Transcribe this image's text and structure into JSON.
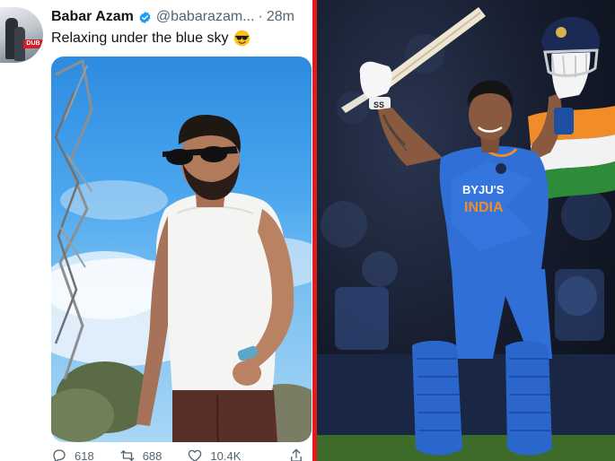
{
  "tweet": {
    "author_name": "Babar Azam",
    "handle": "@babarazam...",
    "separator": "·",
    "time_ago": "28m",
    "text": "Relaxing under the blue sky",
    "emoji": "sunglasses-emoji",
    "avatar_sign_text": "DUB",
    "actions": {
      "replies": "618",
      "retweets": "688",
      "likes": "10.4K"
    }
  },
  "cricket_photo": {
    "jersey_sponsor": "BYJU'S",
    "jersey_team": "INDIA",
    "bat_sticker": "SS"
  },
  "colors": {
    "divider": "#e01b1b",
    "verified": "#1d9bf0",
    "india_jersey": "#2f6fd6",
    "sky": "#3a97e6"
  }
}
